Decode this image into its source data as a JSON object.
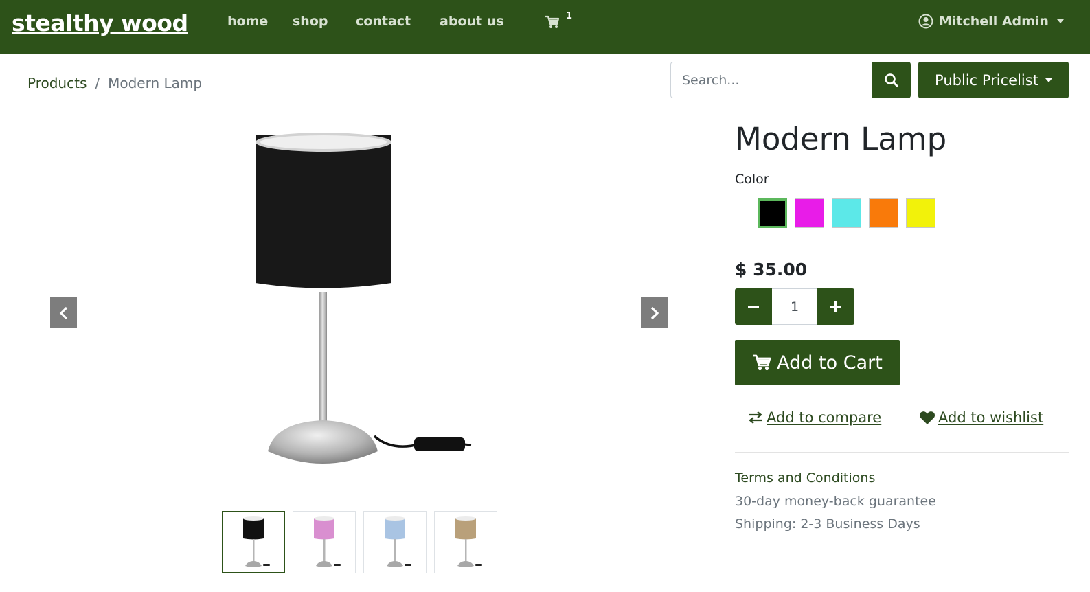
{
  "navbar": {
    "brand": "stealthy wood",
    "links": [
      "home",
      "shop",
      "contact",
      "about us"
    ],
    "cart_count": "1",
    "user": "Mitchell Admin"
  },
  "breadcrumb": {
    "products": "Products",
    "separator": "/",
    "current": "Modern Lamp"
  },
  "search": {
    "placeholder": "Search..."
  },
  "pricelist": {
    "label": "Public Pricelist"
  },
  "product": {
    "title": "Modern Lamp",
    "color_label": "Color",
    "colors": [
      "#000000",
      "#e81ce8",
      "#5ce8e8",
      "#f97a0a",
      "#f2f20a"
    ],
    "selected_color": 0,
    "price": "$ 35.00",
    "quantity": "1",
    "add_to_cart": "Add to Cart",
    "add_to_compare": "Add to compare",
    "add_to_wishlist": "Add to wishlist",
    "terms": "Terms and Conditions",
    "guarantee": "30-day money-back guarantee",
    "shipping": "Shipping: 2-3 Business Days"
  },
  "gallery": {
    "thumbnails": [
      "black-lamp",
      "pink-lamp",
      "light-blue-lamp",
      "beige-lamp"
    ],
    "thumbnail_shade_colors": [
      "#111111",
      "#d98fd0",
      "#a9c4e3",
      "#b9a07a"
    ],
    "active_index": 0
  },
  "colors": {
    "brand_green": "#2d5219"
  }
}
